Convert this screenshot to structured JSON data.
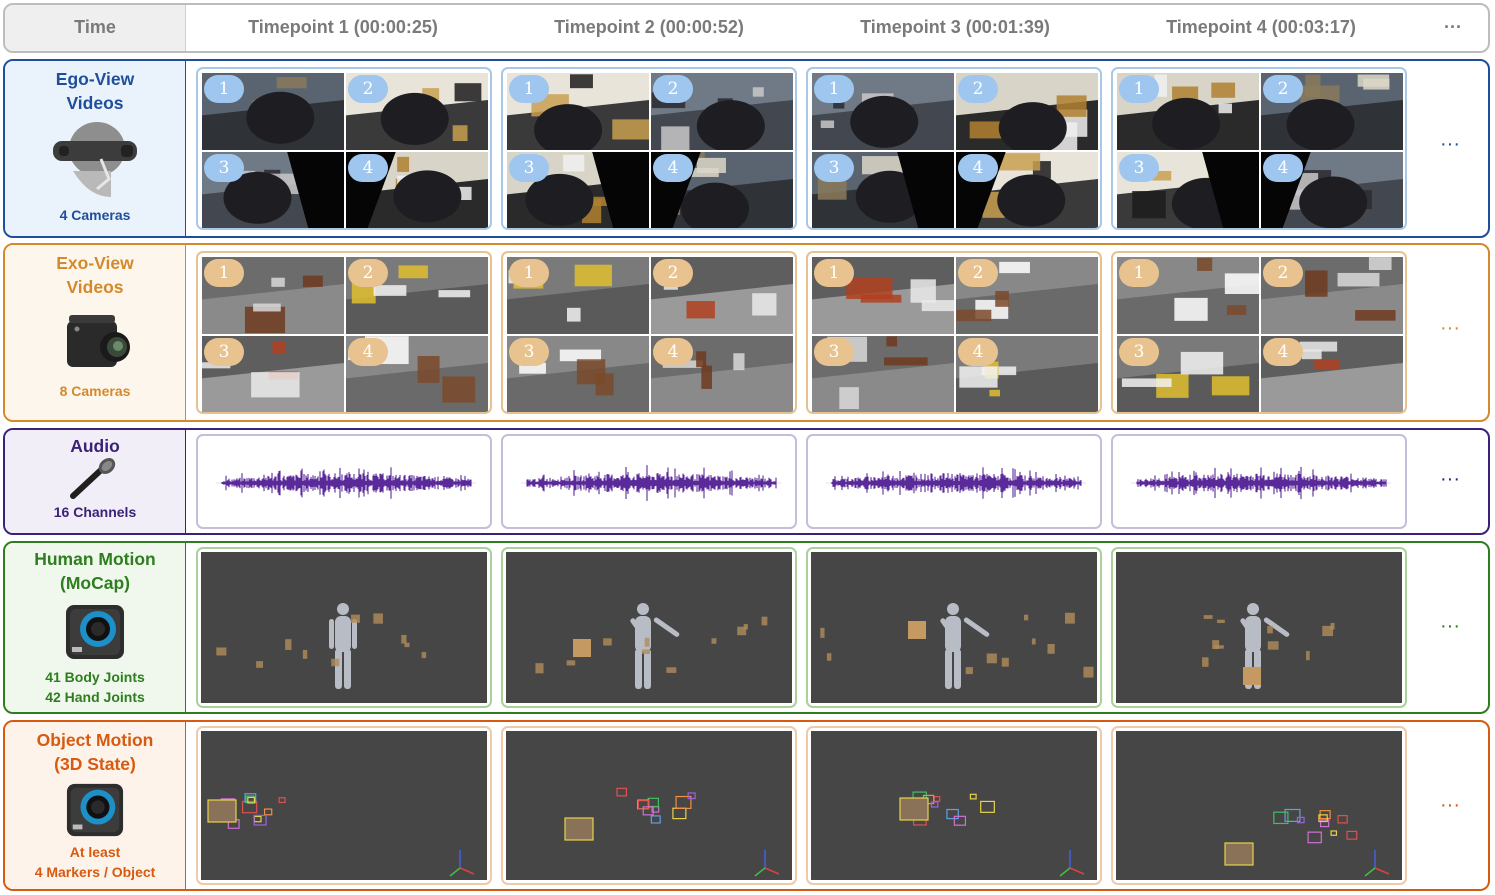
{
  "header": {
    "time_label": "Time",
    "timepoints": [
      "Timepoint 1 (00:00:25)",
      "Timepoint 2 (00:00:52)",
      "Timepoint 3 (00:01:39)",
      "Timepoint 4 (00:03:17)"
    ],
    "ellipsis": "···"
  },
  "rows": {
    "ego": {
      "title_line1": "Ego-View",
      "title_line2": "Videos",
      "sub": "4 Cameras",
      "icon": "headset-camera-icon",
      "color": "#1f4e9c",
      "tint": "#eaf2fb",
      "panel_border": "#a9c8e8"
    },
    "exo": {
      "title_line1": "Exo-View",
      "title_line2": "Videos",
      "sub": "8 Cameras",
      "icon": "camera-icon",
      "color": "#d48a2c",
      "tint": "#fdf6ec",
      "panel_border": "#e8c190"
    },
    "audio": {
      "title_line1": "Audio",
      "sub": "16 Channels",
      "icon": "microphone-icon",
      "color": "#3b2178",
      "tint": "#f2eef8",
      "panel_border": "#c6bcdc"
    },
    "human": {
      "title_line1": "Human Motion",
      "title_line2": "(MoCap)",
      "sub_line1": "41 Body Joints",
      "sub_line2": "42 Hand Joints",
      "icon": "mocap-camera-icon",
      "color": "#2e7d1e",
      "tint": "#f0f8ee",
      "panel_border": "#a9d19a"
    },
    "object": {
      "title_line1": "Object Motion",
      "title_line2": "(3D State)",
      "sub_line1": "At least",
      "sub_line2": "4 Markers / Object",
      "icon": "mocap-camera-icon",
      "color": "#d65a10",
      "tint": "#fdf3ea",
      "panel_border": "#f0c9a8"
    }
  },
  "camera_numbers": [
    "1",
    "2",
    "3",
    "4"
  ],
  "colors": {
    "waveform": "#5b2a9a",
    "render_bg": "#464646",
    "header_border": "#bdbdbd"
  }
}
